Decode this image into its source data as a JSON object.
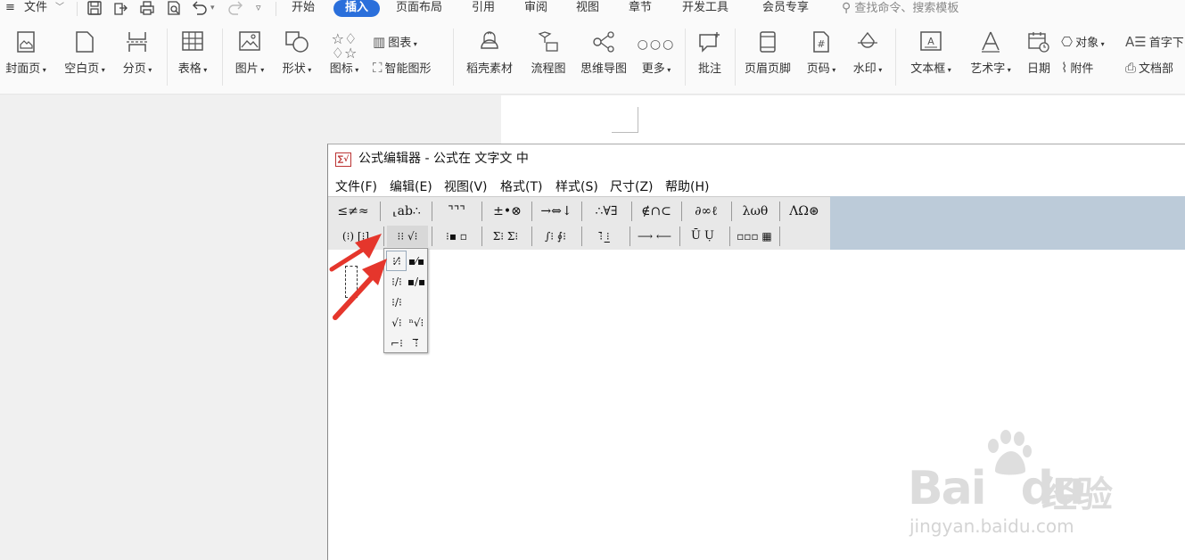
{
  "menubar": {
    "hamburger_icon": "≡",
    "file": "文件",
    "file_caret": "﹀",
    "qa_icons": [
      "save-icon",
      "export-icon",
      "print-icon",
      "preview-icon",
      "undo-icon",
      "redo-icon",
      "customize-icon"
    ],
    "tabs": [
      "开始",
      "插入",
      "页面布局",
      "引用",
      "审阅",
      "视图",
      "章节",
      "开发工具",
      "会员专享"
    ],
    "active_tab": "插入",
    "search_placeholder": "查找命令、搜索模板"
  },
  "ribbon": {
    "buttons": [
      {
        "label": "封面页",
        "arrow": true,
        "icon": "cover-page-icon"
      },
      {
        "label": "空白页",
        "arrow": true,
        "icon": "blank-page-icon"
      },
      {
        "label": "分页",
        "arrow": true,
        "icon": "page-break-icon"
      },
      {
        "label": "表格",
        "arrow": true,
        "icon": "table-icon"
      },
      {
        "label": "图片",
        "arrow": true,
        "icon": "picture-icon"
      },
      {
        "label": "形状",
        "arrow": true,
        "icon": "shape-icon"
      },
      {
        "label": "图标",
        "arrow": true,
        "icon": "icons-icon"
      },
      {
        "label": "稻壳素材",
        "arrow": false,
        "icon": "docer-material-icon"
      },
      {
        "label": "流程图",
        "arrow": false,
        "icon": "flowchart-icon"
      },
      {
        "label": "思维导图",
        "arrow": false,
        "icon": "mindmap-icon"
      },
      {
        "label": "更多",
        "arrow": true,
        "icon": "more-icon"
      },
      {
        "label": "批注",
        "arrow": false,
        "icon": "comment-icon"
      },
      {
        "label": "页眉页脚",
        "arrow": false,
        "icon": "header-footer-icon"
      },
      {
        "label": "页码",
        "arrow": true,
        "icon": "page-number-icon"
      },
      {
        "label": "水印",
        "arrow": true,
        "icon": "watermark-icon"
      },
      {
        "label": "文本框",
        "arrow": true,
        "icon": "textbox-icon"
      },
      {
        "label": "艺术字",
        "arrow": true,
        "icon": "wordart-icon"
      },
      {
        "label": "日期",
        "arrow": false,
        "icon": "date-icon"
      }
    ],
    "small": {
      "chart": "图表",
      "smart_art": "智能图形",
      "object": "对象",
      "attachment": "附件",
      "drop_cap": "首字下",
      "doc_part": "文档部"
    }
  },
  "equation_editor": {
    "title": "公式编辑器 - 公式在 文字文 中",
    "menu": [
      "文件(F)",
      "编辑(E)",
      "视图(V)",
      "格式(T)",
      "样式(S)",
      "尺寸(Z)",
      "帮助(H)"
    ],
    "toolbar_row1": [
      "≤≠≈",
      "⸤ab∴",
      "⌝⌝⌝",
      "±•⊗",
      "→⇔↓",
      "∴∀∃",
      "∉∩⊂",
      "∂∞ℓ",
      "λωθ",
      "ΛΩ⊛"
    ],
    "toolbar_row2": [
      "(⁝) [⁝]",
      "⁝⁝ √⁝",
      "⁝▪ ▫",
      "Σ⁝ Σ⁝",
      "∫⁝ ∮⁝",
      "⁝̄ ⁝̲",
      "⟶ ⟵",
      "Ū Ụ",
      "▫▫▫ ▦"
    ],
    "fraction_palette": [
      "⁝⁄⁝",
      "▪⁄▪",
      "⁝/⁝",
      "▪/▪",
      "⁝/⁝",
      "√⁝",
      "ⁿ√⁝",
      "⌐⁝",
      "⁝̅"
    ]
  },
  "watermark": {
    "brand": "Bai",
    "brand2": "du",
    "product": "经验",
    "url": "jingyan.baidu.com"
  },
  "colors": {
    "accent": "#2a6fdb",
    "toolbar_bg": "#e8e8e8",
    "panel_bg": "#bccbd9",
    "arrow": "#e5362c"
  }
}
